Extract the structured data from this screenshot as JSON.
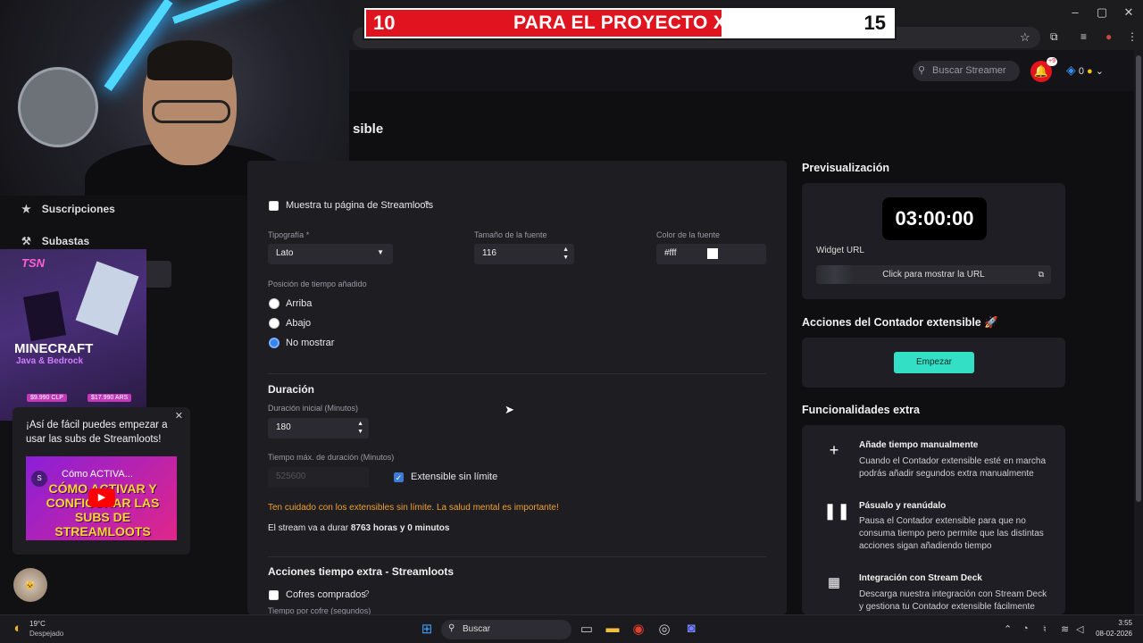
{
  "banner": {
    "left": "10",
    "title": "PARA EL PROYECTO X!!!",
    "right": "15"
  },
  "header": {
    "search_placeholder": "Buscar Streamer",
    "notif_badge": "+9",
    "coins": "0"
  },
  "page": {
    "title_fragment": "sible"
  },
  "sidebar": {
    "items": [
      {
        "label": "Suscripciones",
        "icon": "star-icon"
      },
      {
        "label": "Subastas",
        "icon": "gavel-icon"
      }
    ]
  },
  "ad": {
    "logo": "TSN",
    "title": "MINECRAFT",
    "subtitle": "Java & Bedrock",
    "price1": "$9.990 CLP",
    "price2": "$17.990 ARS"
  },
  "popup": {
    "text": "¡Así de fácil puedes empezar a usar las subs de Streamloots!",
    "video_title": "Cómo ACTIVA...",
    "video_big": "CÓMO ACTIVAR Y CONFIGURAR LAS SUBS DE STREAMLOOTS"
  },
  "form": {
    "show_page_label": "Muestra tu página de Streamloots",
    "typography_label": "Tipografía *",
    "typography_value": "Lato",
    "font_size_label": "Tamaño de la fuente",
    "font_size_value": "116",
    "font_color_label": "Color de la fuente",
    "font_color_value": "#fff",
    "position_label": "Posición de tiempo añadido",
    "position_options": [
      "Arriba",
      "Abajo",
      "No mostrar"
    ],
    "position_selected": "No mostrar",
    "duration_title": "Duración",
    "initial_duration_label": "Duración inicial (Minutos)",
    "initial_duration_value": "180",
    "max_duration_label": "Tiempo máx. de duración (Minutos)",
    "max_duration_placeholder": "525600",
    "unlimited_label": "Extensible sin límite",
    "warning": "Ten cuidado con los extensibles sin límite. La salud mental es importante!",
    "stream_duration_prefix": "El stream va a durar",
    "stream_duration_value": "8763 horas y 0 minutos",
    "extra_title": "Acciones tiempo extra - Streamloots",
    "chests_label": "Cofres comprados",
    "per_chest_label": "Tiempo por cofre (segundos)"
  },
  "preview": {
    "title": "Previsualización",
    "timer": "03:00:00",
    "widget_url_label": "Widget URL",
    "url_button": "Click para mostrar la URL"
  },
  "actions": {
    "title": "Acciones del Contador extensible",
    "start_button": "Empezar"
  },
  "extras": {
    "title": "Funcionalidades extra",
    "items": [
      {
        "icon": "plus-icon",
        "title": "Añade tiempo manualmente",
        "desc": "Cuando el Contador extensible esté en marcha podrás añadir segundos extra manualmente"
      },
      {
        "icon": "pause-icon",
        "title": "Pásualo y reanúdalo",
        "desc": "Pausa el Contador extensible para que no consuma tiempo pero permite que las distintas acciones sigan añadiendo tiempo"
      },
      {
        "icon": "stream-deck-icon",
        "title": "Integración con Stream Deck",
        "desc": "Descarga nuestra integración con Stream Deck y gestiona tu Contador extensible fácilmente"
      }
    ]
  },
  "taskbar": {
    "weather_temp": "19°C",
    "weather_desc": "Despejado",
    "search": "Buscar",
    "time": "3:55",
    "date": "08-02-2026"
  }
}
